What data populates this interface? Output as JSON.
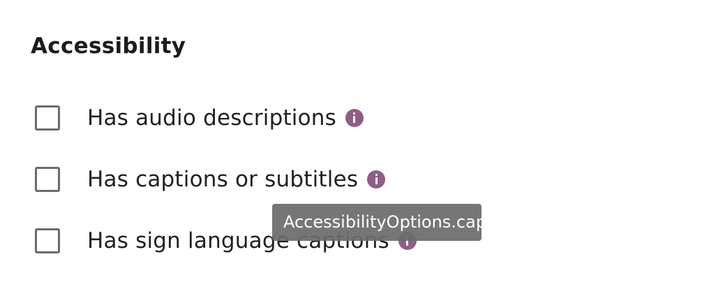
{
  "section": {
    "title": "Accessibility"
  },
  "options": [
    {
      "label": "Has audio descriptions",
      "checked": false,
      "icon": "info-icon"
    },
    {
      "label": "Has captions or subtitles",
      "checked": false,
      "icon": "info-icon"
    },
    {
      "label": "Has sign language captions",
      "checked": false,
      "icon": "info-icon"
    }
  ],
  "tooltip": {
    "text": "AccessibilityOptions.cap"
  },
  "colors": {
    "info_icon": "#8d5f87",
    "checkbox_border": "#6b6b6b",
    "tooltip_bg": "#6c6c6c"
  }
}
